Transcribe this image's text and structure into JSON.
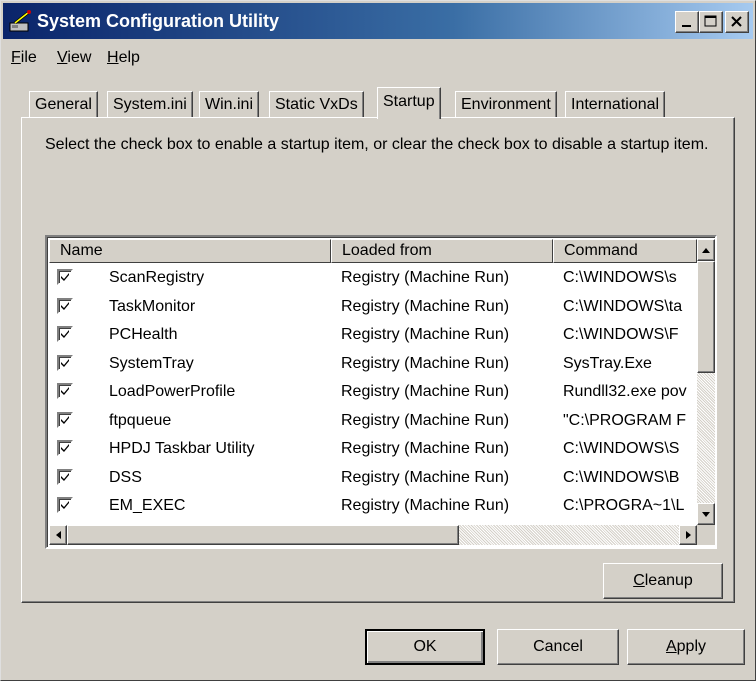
{
  "window": {
    "title": "System Configuration Utility",
    "icon": "msconfig-app-icon",
    "controls": [
      "minimize-icon",
      "maximize-icon",
      "close-icon"
    ]
  },
  "menu": [
    {
      "label_ul": "F",
      "label_rest": "ile"
    },
    {
      "label_ul": "V",
      "label_rest": "iew"
    },
    {
      "label_ul": "H",
      "label_rest": "elp"
    }
  ],
  "tabs": [
    {
      "label": "General"
    },
    {
      "label": "System.ini"
    },
    {
      "label": "Win.ini"
    },
    {
      "label": "Static VxDs"
    },
    {
      "label": "Startup"
    },
    {
      "label": "Environment"
    },
    {
      "label": "International"
    }
  ],
  "active_tab": "Startup",
  "description": "Select the check box to enable a startup item, or clear the check box to disable a startup item.",
  "list": {
    "columns": [
      "Name",
      "Loaded from",
      "Command"
    ],
    "rows": [
      {
        "checked": true,
        "name": "ScanRegistry",
        "loaded_from": "Registry (Machine Run)",
        "command": "C:\\WINDOWS\\s"
      },
      {
        "checked": true,
        "name": "TaskMonitor",
        "loaded_from": "Registry (Machine Run)",
        "command": "C:\\WINDOWS\\ta"
      },
      {
        "checked": true,
        "name": "PCHealth",
        "loaded_from": "Registry (Machine Run)",
        "command": "C:\\WINDOWS\\F"
      },
      {
        "checked": true,
        "name": "SystemTray",
        "loaded_from": "Registry (Machine Run)",
        "command": "SysTray.Exe"
      },
      {
        "checked": true,
        "name": "LoadPowerProfile",
        "loaded_from": "Registry (Machine Run)",
        "command": "Rundll32.exe pov"
      },
      {
        "checked": true,
        "name": "ftpqueue",
        "loaded_from": "Registry (Machine Run)",
        "command": "\"C:\\PROGRAM F"
      },
      {
        "checked": true,
        "name": "HPDJ Taskbar Utility",
        "loaded_from": "Registry (Machine Run)",
        "command": "C:\\WINDOWS\\S"
      },
      {
        "checked": true,
        "name": "DSS",
        "loaded_from": "Registry (Machine Run)",
        "command": "C:\\WINDOWS\\B"
      },
      {
        "checked": true,
        "name": "EM_EXEC",
        "loaded_from": "Registry (Machine Run)",
        "command": "C:\\PROGRA~1\\L"
      }
    ]
  },
  "buttons": {
    "cleanup_ul": "C",
    "cleanup_rest": "leanup",
    "ok": "OK",
    "cancel": "Cancel",
    "apply_ul": "A",
    "apply_rest": "pply"
  }
}
